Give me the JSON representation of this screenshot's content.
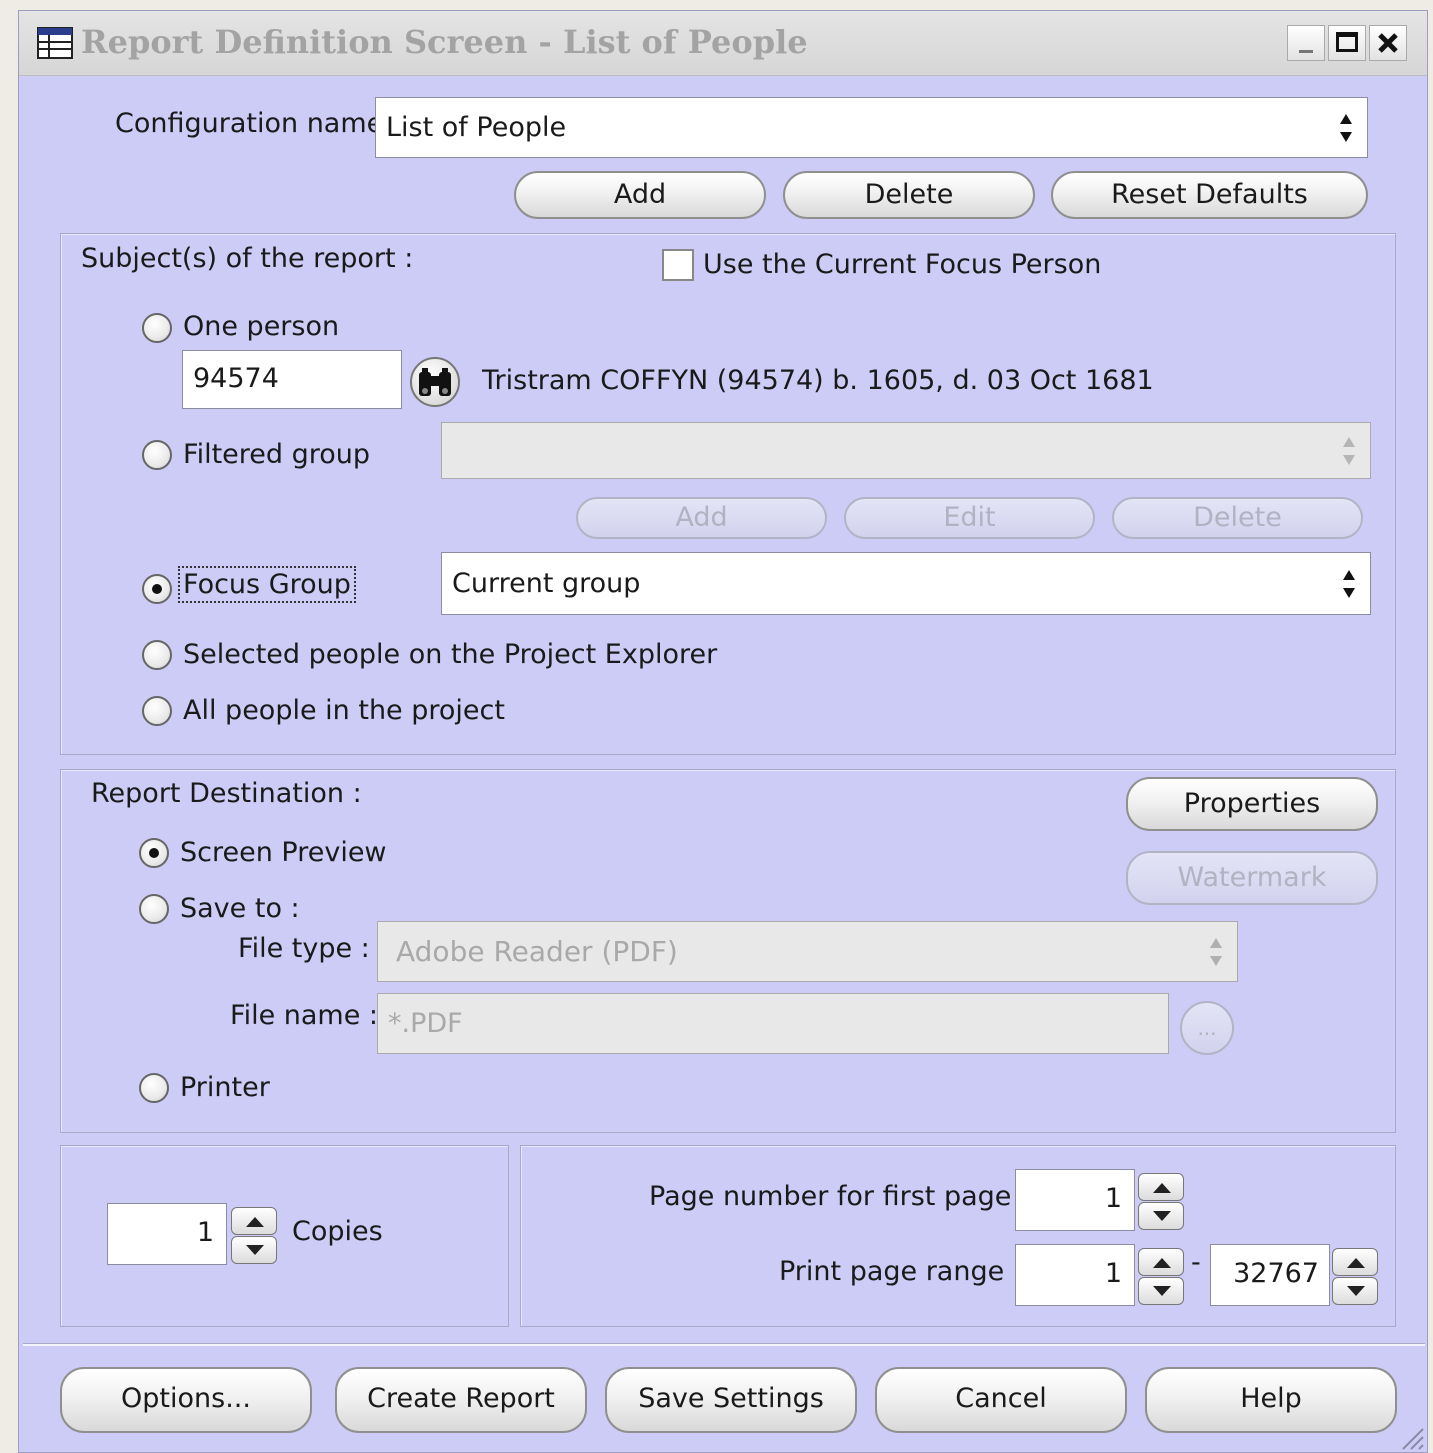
{
  "window": {
    "title": "Report Definition Screen - List of People",
    "icon": "report-table-icon",
    "controls": [
      "minimize-icon",
      "maximize-icon",
      "close-icon"
    ]
  },
  "config": {
    "label": "Configuration name",
    "value": "List of People",
    "buttons": {
      "add": "Add",
      "delete": "Delete",
      "reset": "Reset Defaults"
    }
  },
  "subjects": {
    "title": "Subject(s) of the report :",
    "use_focus_person": {
      "label": "Use the Current Focus Person",
      "checked": false
    },
    "one_person": {
      "label": "One person",
      "selected": false,
      "id_value": "94574",
      "description": "Tristram COFFYN (94574) b. 1605, d. 03 Oct 1681",
      "icon": "binoculars-icon"
    },
    "filtered_group": {
      "label": "Filtered group",
      "selected": false,
      "value": "",
      "buttons": {
        "add": "Add",
        "edit": "Edit",
        "delete": "Delete"
      }
    },
    "focus_group": {
      "label": "Focus Group",
      "selected": true,
      "value": "Current group"
    },
    "selected_people": {
      "label": "Selected people on the Project Explorer",
      "selected": false
    },
    "all_people": {
      "label": "All people in the project",
      "selected": false
    }
  },
  "destination": {
    "title": "Report Destination :",
    "properties_button": "Properties",
    "watermark_button": "Watermark",
    "screen_preview": {
      "label": "Screen Preview",
      "selected": true
    },
    "save_to": {
      "label": "Save to :",
      "selected": false
    },
    "file_type": {
      "label": "File type :",
      "value": "Adobe Reader (PDF)"
    },
    "file_name": {
      "label": "File name :",
      "value": "*.PDF",
      "browse": "..."
    },
    "printer": {
      "label": "Printer",
      "selected": false
    }
  },
  "copies": {
    "value": "1",
    "label": "Copies"
  },
  "pages": {
    "first_page_label": "Page number for first page :",
    "first_page_value": "1",
    "range_label": "Print page range :",
    "range_from": "1",
    "range_sep": "-",
    "range_to": "32767"
  },
  "footer": {
    "options": "Options...",
    "create": "Create Report",
    "save": "Save Settings",
    "cancel": "Cancel",
    "help": "Help"
  }
}
